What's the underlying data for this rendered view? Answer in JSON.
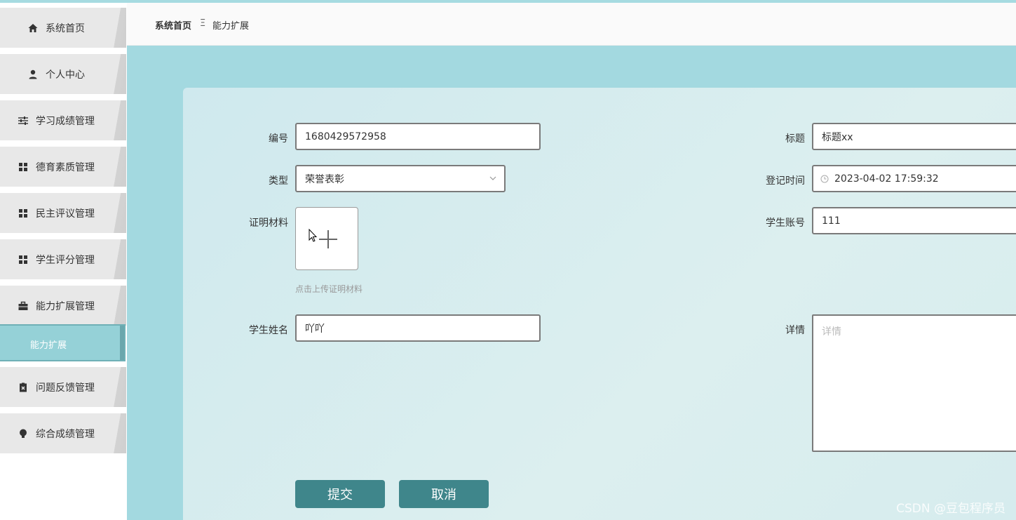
{
  "sidebar": {
    "items": [
      {
        "label": "系统首页",
        "icon": "home-icon"
      },
      {
        "label": "个人中心",
        "icon": "user-icon"
      },
      {
        "label": "学习成绩管理",
        "icon": "sliders-icon"
      },
      {
        "label": "德育素质管理",
        "icon": "grid-icon"
      },
      {
        "label": "民主评议管理",
        "icon": "grid-icon"
      },
      {
        "label": "学生评分管理",
        "icon": "grid-icon"
      },
      {
        "label": "能力扩展管理",
        "icon": "briefcase-icon"
      },
      {
        "label": "问题反馈管理",
        "icon": "clipboard-x-icon"
      },
      {
        "label": "综合成绩管理",
        "icon": "bulb-icon"
      }
    ],
    "active_sub": "能力扩展"
  },
  "breadcrumb": {
    "home": "系统首页",
    "separator": "Ξ",
    "current": "能力扩展"
  },
  "form": {
    "number": {
      "label": "编号",
      "value": "1680429572958"
    },
    "title": {
      "label": "标题",
      "value": "标题xx"
    },
    "type": {
      "label": "类型",
      "value": "荣誉表彰"
    },
    "register_time": {
      "label": "登记时间",
      "value": "2023-04-02 17:59:32"
    },
    "proof": {
      "label": "证明材料",
      "hint": "点击上传证明材料"
    },
    "student_account": {
      "label": "学生账号",
      "value": "111"
    },
    "student_name": {
      "label": "学生姓名",
      "value": "吖吖"
    },
    "details": {
      "label": "详情",
      "placeholder": "详情"
    },
    "submit_label": "提交",
    "cancel_label": "取消"
  },
  "watermark": "CSDN @豆包程序员",
  "colors": {
    "accent": "#3f868b",
    "main_bg": "#a3d9e0",
    "active_menu": "#95d1d7"
  }
}
